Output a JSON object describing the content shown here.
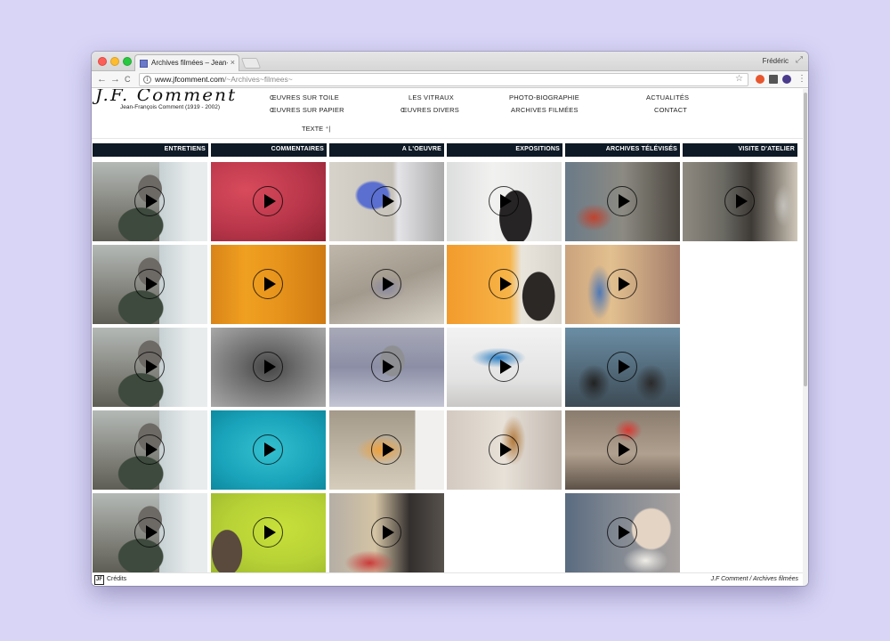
{
  "browser": {
    "tab_title": "Archives filmées – Jean-Franç",
    "tab_close": "×",
    "profile": "Frédéric",
    "url_host": "www.jfcomment.com",
    "url_path": "/~Archives~filmees~",
    "back": "←",
    "forward": "→",
    "reload": "C",
    "star": "☆",
    "menu": "⋮"
  },
  "site": {
    "logo_text": "J.F. Comment",
    "logo_sub": "Jean-François Comment (1919 - 2002)",
    "nav": [
      "ŒUVRES SUR TOILE",
      "LES VITRAUX",
      "PHOTO-BIOGRAPHIE",
      "ACTUALITÉS",
      "ŒUVRES SUR PAPIER",
      "ŒUVRES DIVERS",
      "ARCHIVES FILMÉES",
      "CONTACT"
    ],
    "texte": "TEXTE ⁺|"
  },
  "categories": [
    "ENTRETIENS",
    "COMMENTAIRES",
    "A L'OEUVRE",
    "EXPOSITIONS",
    "ARCHIVES TÉLÉVISÉS",
    "VISITE D'ATELIER"
  ],
  "video_columns": [
    [
      "interview-painter",
      "interview-painter",
      "interview-painter",
      "interview-painter",
      "interview-painter"
    ],
    [
      "red-canvas",
      "orange-canvas",
      "grey-canvas",
      "turquoise-canvas",
      "green-canvas-hand"
    ],
    [
      "painter-at-easel",
      "painting-floor",
      "painter-crouching",
      "watercolor-palette",
      "studio-paintings"
    ],
    [
      "gallery-man-coat",
      "man-orange-painting",
      "gallery-blue-painting",
      "church-exhibition"
    ],
    [
      "studio-red-painting",
      "landscape-painting",
      "tv-interview-two-men",
      "tv-interview-group",
      "man-reading-book"
    ],
    [
      "studio-visit"
    ]
  ],
  "footer": {
    "credits_icon": "JF",
    "credits": "Crédits",
    "crumb": "J.F Comment / Archives filmées"
  }
}
